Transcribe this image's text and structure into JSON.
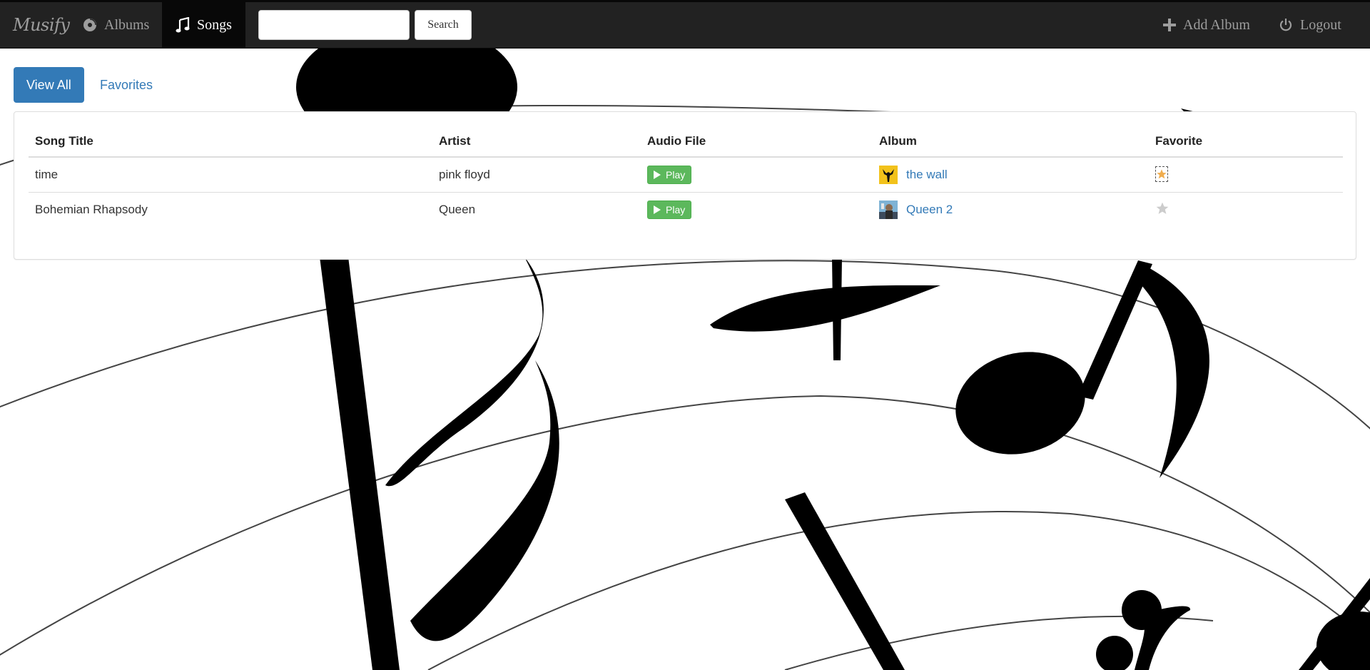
{
  "navbar": {
    "brand": "Musify",
    "albums_label": "Albums",
    "songs_label": "Songs",
    "search_placeholder": "",
    "search_value": "",
    "search_button": "Search",
    "add_album_label": "Add Album",
    "logout_label": "Logout",
    "active_tab": "Songs",
    "icons": {
      "albums": "disc-icon",
      "songs": "music-note-icon",
      "add_album": "plus-icon",
      "logout": "power-icon"
    }
  },
  "filters": {
    "view_all": "View All",
    "favorites": "Favorites",
    "active": "View All"
  },
  "table": {
    "headers": [
      "Song Title",
      "Artist",
      "Audio File",
      "Album",
      "Favorite"
    ],
    "rows": [
      {
        "title": "time",
        "artist": "pink floyd",
        "audio": "Play",
        "album": "the wall",
        "album_cover": "the-wall-cover",
        "favorite": true
      },
      {
        "title": "Bohemian Rhapsody",
        "artist": "Queen",
        "audio": "Play",
        "album": "Queen 2",
        "album_cover": "queen-2-cover",
        "favorite": false
      }
    ]
  },
  "colors": {
    "navbar_bg": "#222222",
    "accent": "#337ab7",
    "play_button": "#5cb85c",
    "favorite_active": "#f0ad4e",
    "favorite_inactive": "#cccccc"
  },
  "background": "music-notes-staff-illustration"
}
